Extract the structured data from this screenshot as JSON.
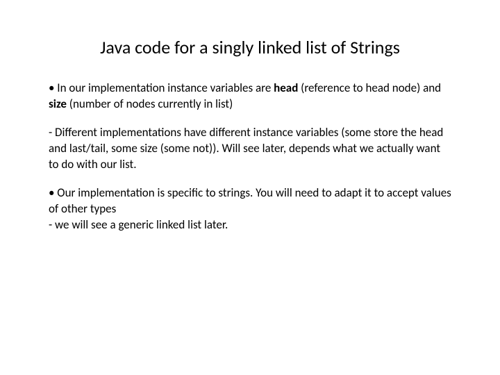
{
  "title": "Java code for a singly linked list of Strings",
  "p1_a": "• In our implementation instance variables are ",
  "p1_head": "head",
  "p1_b": " (reference to head node) and ",
  "p1_size": "size",
  "p1_c": " (number of nodes currently in list)",
  "p2": " - Different implementations have different instance variables (some store the head and last/tail, some size (some not)). Will see later, depends what we actually want to do with our list.",
  "p3a": "• Our implementation is specific to strings. You will need to adapt it to accept values of other types",
  "p3b": " - we will see a generic linked list later."
}
